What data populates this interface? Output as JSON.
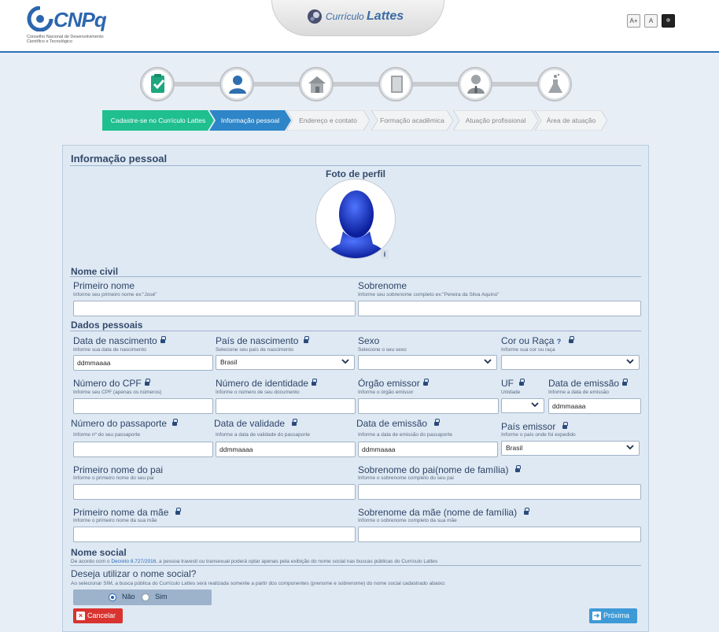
{
  "header": {
    "logo_text": "CNPq",
    "logo_subtitle": "Conselho Nacional de Desenvolvimento Científico e Tecnológico",
    "app_prefix": "Currículo",
    "app_name": "Lattes",
    "font_increase": "A+",
    "font_normal": "A"
  },
  "steps": [
    {
      "icon": "checklist-icon"
    },
    {
      "icon": "person-icon"
    },
    {
      "icon": "house-icon"
    },
    {
      "icon": "book-icon"
    },
    {
      "icon": "professional-icon"
    },
    {
      "icon": "flask-icon"
    }
  ],
  "breadcrumb": [
    {
      "label": "Cadastre-se no Currículo Lattes",
      "state": "done"
    },
    {
      "label": "Informação pessoal",
      "state": "active"
    },
    {
      "label": "Endereço e contato",
      "state": "pending"
    },
    {
      "label": "Formação acadêmica",
      "state": "pending"
    },
    {
      "label": "Atuação profissional",
      "state": "pending"
    },
    {
      "label": "Área de atuação",
      "state": "pending"
    }
  ],
  "colors": {
    "done": "#1fbf8f",
    "active": "#2e86c9",
    "pending": "#f1f3f5",
    "cancel": "#d9332f",
    "next": "#3e9ad6"
  },
  "form": {
    "title": "Informação pessoal",
    "photo_label": "Foto de perfil",
    "nome_civil": "Nome civil",
    "primeiro_nome": {
      "label": "Primeiro nome",
      "hint": "Informe seu primeiro nome ex:\"José\"",
      "value": ""
    },
    "sobrenome": {
      "label": "Sobrenome",
      "hint": "Informe seu sobrenome completo ex:\"Pereira da Silva Aquino\"",
      "value": ""
    },
    "dados_pessoais": "Dados pessoais",
    "data_nascimento": {
      "label": "Data de nascimento",
      "hint": "Informe sua data de nascimento",
      "value": "ddmmaaaa"
    },
    "pais_nascimento": {
      "label": "País de nascimento",
      "hint": "Selecione seu país de nascimento",
      "value": "Brasil"
    },
    "sexo": {
      "label": "Sexo",
      "hint": "Selecione o seu sexo",
      "value": ""
    },
    "cor_raca": {
      "label": "Cor ou Raça",
      "hint": "Informe sua cor ou raça",
      "help": "?",
      "value": ""
    },
    "cpf": {
      "label": "Número do CPF",
      "hint": "Informe seu CPF (apenas os números)",
      "value": ""
    },
    "identidade": {
      "label": "Número de identidade",
      "hint": "Informe o número de seu documento",
      "value": ""
    },
    "orgao": {
      "label": "Órgão emissor",
      "hint": "Informe o órgão emissor",
      "value": ""
    },
    "uf": {
      "label": "UF",
      "hint": "Unidade",
      "value": ""
    },
    "data_emissao": {
      "label": "Data de emissão",
      "hint": "Informe a data de emissão",
      "value": "ddmmaaaa"
    },
    "passaporte": {
      "label": "Número do passaporte",
      "hint": "Informe nº do seu passaporte",
      "value": ""
    },
    "validade": {
      "label": "Data de validade",
      "hint": "Informe a data de validade do passaporte",
      "value": "ddmmaaaa"
    },
    "emissao_pass": {
      "label": "Data de emissão",
      "hint": "Informe a data de emissão do passaporte",
      "value": "ddmmaaaa"
    },
    "pais_emissor": {
      "label": "País emissor",
      "hint": "Informe o país onde foi expedido",
      "value": "Brasil"
    },
    "pai_nome": {
      "label": "Primeiro nome do pai",
      "hint": "Informe o primeiro nome do seu pai",
      "value": ""
    },
    "pai_sobrenome": {
      "label": "Sobrenome do pai(nome de família)",
      "hint": "Informe o sobrenome completo do seu pai",
      "value": ""
    },
    "mae_nome": {
      "label": "Primeiro nome da mãe",
      "hint": "Informe o primeiro nome da sua mãe",
      "value": ""
    },
    "mae_sobrenome": {
      "label": "Sobrenome da mãe (nome de família)",
      "hint": "Informe o sobrenome completo da sua mãe",
      "value": ""
    },
    "nome_social": "Nome social",
    "nome_social_note_pre": "De acordo com o ",
    "nome_social_link": "Decreto 8.727/2016",
    "nome_social_note_post": ", a pessoa travesti ou transexual poderá optar apenas pela exibição do nome social nas buscas públicas do Currículo Lattes",
    "usar_nome_social": "Deseja utilizar o nome social?",
    "usar_nome_social_hint": "Ao selecionar SIM, a busca pública do Currículo Lattes será realizada somente a partir dos componentes (prenome e sobrenome) do nome social cadastrado abaixo:",
    "nao": "Não",
    "sim": "Sim",
    "selected": "Não"
  },
  "buttons": {
    "cancel": "Cancelar",
    "next": "Próxima"
  }
}
